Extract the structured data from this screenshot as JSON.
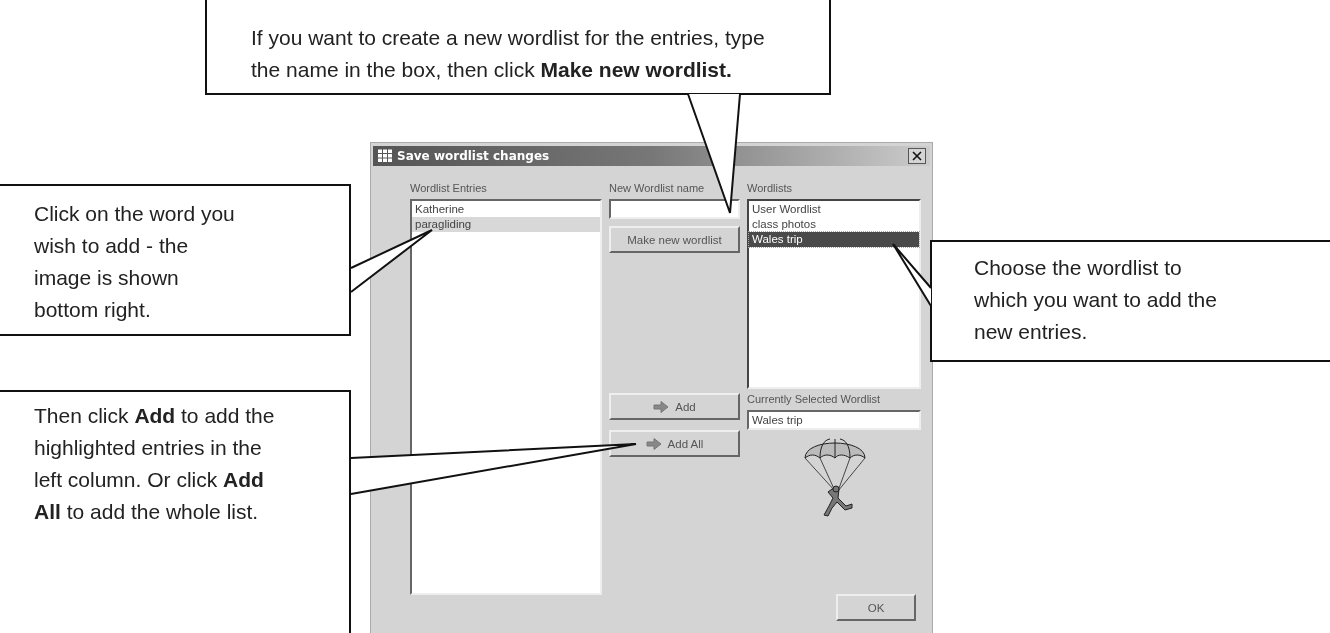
{
  "callouts": [
    {
      "text": "If you want to create a new wordlist for the entries, type the name in the box, then click **Make new wordlist.**"
    },
    {
      "text": "Click on the word you wish to add - the image is shown bottom right."
    },
    {
      "text": "Then click **Add** to add the highlighted entries in the left column. Or click **Add All** to add the whole list."
    },
    {
      "text": "Choose the wordlist to which you want to add the new entries."
    }
  ],
  "window": {
    "title": "Save wordlist changes"
  },
  "entries": {
    "label": "Wordlist Entries",
    "active": false,
    "items": [
      {
        "text": "Katherine",
        "selected": false
      },
      {
        "text": "paragliding",
        "selected": true
      }
    ]
  },
  "new_wordlist": {
    "label": "New Wordlist name",
    "button": "Make new wordlist"
  },
  "wordlists": {
    "label": "Wordlists",
    "active": true,
    "items": [
      {
        "text": "User Wordlist",
        "selected": false
      },
      {
        "text": "class photos",
        "selected": false
      },
      {
        "text": "Wales trip",
        "selected": true
      }
    ]
  },
  "add_buttons": [
    "Add",
    "Add All"
  ],
  "current": {
    "label": "Currently Selected Wordlist",
    "value": "Wales trip"
  },
  "ok_button": "OK"
}
